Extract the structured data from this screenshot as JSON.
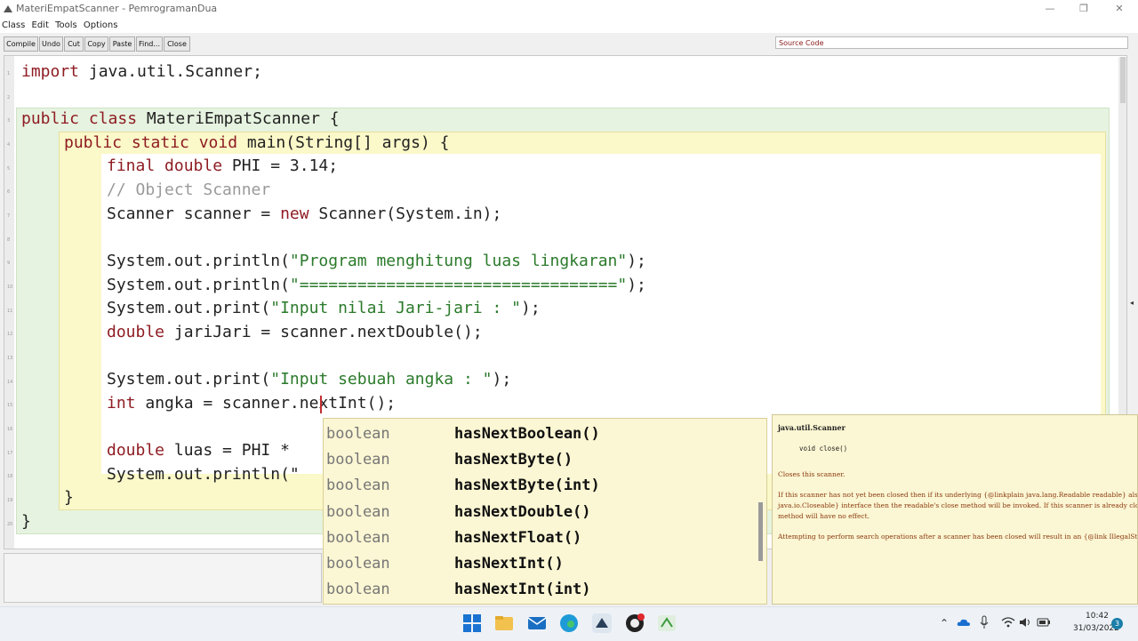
{
  "window": {
    "title": "MateriEmpatScanner - PemrogramanDua",
    "minimize_glyph": "—",
    "maximize_glyph": "❐",
    "close_glyph": "✕"
  },
  "menu": [
    "Class",
    "Edit",
    "Tools",
    "Options"
  ],
  "toolbar": {
    "buttons": [
      "Compile",
      "Undo",
      "Cut",
      "Copy",
      "Paste",
      "Find...",
      "Close"
    ],
    "view_select": "Source Code"
  },
  "line_numbers": [
    "1",
    "2",
    "3",
    "4",
    "5",
    "6",
    "7",
    "8",
    "9",
    "10",
    "11",
    "12",
    "13",
    "14",
    "15",
    "16",
    "17",
    "18",
    "19",
    "20"
  ],
  "code": {
    "l1_kw": "import",
    "l1_rest": " java.util.Scanner;",
    "l3_kw": "public class",
    "l3_rest": " MateriEmpatScanner {",
    "l4_kw": "public static void",
    "l4_rest": " main(String[] args) {",
    "l5_kw1": "final",
    "l5_kw2": " double",
    "l5_rest": " PHI = 3.14;",
    "l6_comment": "// Object Scanner",
    "l7_a": "Scanner scanner = ",
    "l7_kw": "new",
    "l7_b": " Scanner(System.in);",
    "l9_a": "System.out.println(",
    "l9_str": "\"Program menghitung luas lingkaran\"",
    "l9_b": ");",
    "l10_a": "System.out.println(",
    "l10_str": "\"=================================\"",
    "l10_b": ");",
    "l11_a": "System.out.print(",
    "l11_str": "\"Input nilai Jari-jari : \"",
    "l11_b": ");",
    "l12_kw": "double",
    "l12_rest": " jariJari = scanner.nextDouble();",
    "l14_a": "System.out.print(",
    "l14_str": "\"Input sebuah angka : \"",
    "l14_b": ");",
    "l15_kw": "int",
    "l15_rest": " angka = scanner.nextInt();",
    "l17_kw": "double",
    "l17_rest": " luas = PHI *",
    "l18_a": "System.out.println(\"",
    "l19_brace": "}",
    "l20_brace": "}"
  },
  "autocomplete": {
    "items": [
      {
        "type": "boolean",
        "name": "hasNextBoolean()"
      },
      {
        "type": "boolean",
        "name": "hasNextByte()"
      },
      {
        "type": "boolean",
        "name": "hasNextByte(int)"
      },
      {
        "type": "boolean",
        "name": "hasNextDouble()"
      },
      {
        "type": "boolean",
        "name": "hasNextFloat()"
      },
      {
        "type": "boolean",
        "name": "hasNextInt()"
      },
      {
        "type": "boolean",
        "name": "hasNextInt(int)"
      }
    ]
  },
  "doc": {
    "class_name": "java.util.Scanner",
    "signature": "void close()",
    "description": "Closes this scanner.",
    "para1": "If this scanner has not yet been closed then if its underlying {@linkplain java.lang.Readable readable} also i java.io.Closeable} interface then the readable's close method will be invoked. If this scanner is already clo method will have no effect.",
    "para2": "Attempting to perform search operations after a scanner has been closed will result in an {@link IllegalStat"
  },
  "taskbar": {
    "time": "10:42",
    "date": "31/03/2022",
    "notifications": "3"
  },
  "colors": {
    "keyword": "#8e1c23",
    "string": "#2b7a2b",
    "comment": "#9a9a9a",
    "class_scope": "#e6f3e0",
    "method_scope": "#fbf8c9",
    "popup_bg": "#fbf6d3"
  }
}
